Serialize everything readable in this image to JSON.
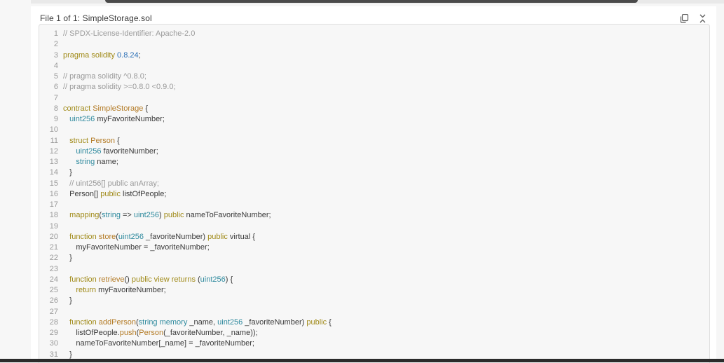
{
  "header": {
    "file_title": "File 1 of 1: SimpleStorage.sol",
    "copy_icon": "copy-icon",
    "collapse_icon": "collapse-icon"
  },
  "code": {
    "language": "solidity",
    "lines": [
      [
        {
          "t": "// SPDX-License-Identifier: Apache-2.0",
          "c": "cm"
        }
      ],
      [],
      [
        {
          "t": "pragma solidity ",
          "c": "kw"
        },
        {
          "t": "0.8.24",
          "c": "num"
        },
        {
          "t": ";",
          "c": ""
        }
      ],
      [],
      [
        {
          "t": "// pragma solidity ^0.8.0;",
          "c": "cm"
        }
      ],
      [
        {
          "t": "// pragma solidity >=0.8.0 <0.9.0;",
          "c": "cm"
        }
      ],
      [],
      [
        {
          "t": "contract ",
          "c": "kw"
        },
        {
          "t": "SimpleStorage",
          "c": "fn"
        },
        {
          "t": " {",
          "c": ""
        }
      ],
      [
        {
          "t": "   ",
          "c": ""
        },
        {
          "t": "uint256",
          "c": "ty"
        },
        {
          "t": " myFavoriteNumber;",
          "c": ""
        }
      ],
      [],
      [
        {
          "t": "   ",
          "c": ""
        },
        {
          "t": "struct ",
          "c": "kw"
        },
        {
          "t": "Person",
          "c": "fn"
        },
        {
          "t": " {",
          "c": ""
        }
      ],
      [
        {
          "t": "      ",
          "c": ""
        },
        {
          "t": "uint256",
          "c": "ty"
        },
        {
          "t": " favoriteNumber;",
          "c": ""
        }
      ],
      [
        {
          "t": "      ",
          "c": ""
        },
        {
          "t": "string",
          "c": "ty"
        },
        {
          "t": " name;",
          "c": ""
        }
      ],
      [
        {
          "t": "   }",
          "c": ""
        }
      ],
      [
        {
          "t": "   // uint256[] public anArray;",
          "c": "cm"
        }
      ],
      [
        {
          "t": "   Person[] ",
          "c": ""
        },
        {
          "t": "public",
          "c": "kw"
        },
        {
          "t": " listOfPeople;",
          "c": ""
        }
      ],
      [],
      [
        {
          "t": "   ",
          "c": ""
        },
        {
          "t": "mapping",
          "c": "kw"
        },
        {
          "t": "(",
          "c": ""
        },
        {
          "t": "string",
          "c": "ty"
        },
        {
          "t": " => ",
          "c": ""
        },
        {
          "t": "uint256",
          "c": "ty"
        },
        {
          "t": ") ",
          "c": ""
        },
        {
          "t": "public",
          "c": "kw"
        },
        {
          "t": " nameToFavoriteNumber;",
          "c": ""
        }
      ],
      [],
      [
        {
          "t": "   ",
          "c": ""
        },
        {
          "t": "function ",
          "c": "kw"
        },
        {
          "t": "store",
          "c": "fn"
        },
        {
          "t": "(",
          "c": ""
        },
        {
          "t": "uint256",
          "c": "ty"
        },
        {
          "t": " _favoriteNumber) ",
          "c": ""
        },
        {
          "t": "public",
          "c": "kw"
        },
        {
          "t": " virtual {",
          "c": ""
        }
      ],
      [
        {
          "t": "      myFavoriteNumber = _favoriteNumber;",
          "c": ""
        }
      ],
      [
        {
          "t": "   }",
          "c": ""
        }
      ],
      [],
      [
        {
          "t": "   ",
          "c": ""
        },
        {
          "t": "function ",
          "c": "kw"
        },
        {
          "t": "retrieve",
          "c": "fn"
        },
        {
          "t": "() ",
          "c": ""
        },
        {
          "t": "public view returns",
          "c": "kw"
        },
        {
          "t": " (",
          "c": ""
        },
        {
          "t": "uint256",
          "c": "ty"
        },
        {
          "t": ") {",
          "c": ""
        }
      ],
      [
        {
          "t": "      ",
          "c": ""
        },
        {
          "t": "return",
          "c": "kw"
        },
        {
          "t": " myFavoriteNumber;",
          "c": ""
        }
      ],
      [
        {
          "t": "   }",
          "c": ""
        }
      ],
      [],
      [
        {
          "t": "   ",
          "c": ""
        },
        {
          "t": "function ",
          "c": "kw"
        },
        {
          "t": "addPerson",
          "c": "fn"
        },
        {
          "t": "(",
          "c": ""
        },
        {
          "t": "string memory",
          "c": "ty"
        },
        {
          "t": " _name, ",
          "c": ""
        },
        {
          "t": "uint256",
          "c": "ty"
        },
        {
          "t": " _favoriteNumber) ",
          "c": ""
        },
        {
          "t": "public",
          "c": "kw"
        },
        {
          "t": " {",
          "c": ""
        }
      ],
      [
        {
          "t": "      listOfPeople.",
          "c": ""
        },
        {
          "t": "push",
          "c": "fn"
        },
        {
          "t": "(",
          "c": ""
        },
        {
          "t": "Person",
          "c": "fn"
        },
        {
          "t": "(_favoriteNumber, _name));",
          "c": ""
        }
      ],
      [
        {
          "t": "      nameToFavoriteNumber[_name] = _favoriteNumber;",
          "c": ""
        }
      ],
      [
        {
          "t": "   }",
          "c": ""
        }
      ]
    ]
  },
  "colors": {
    "keyword": "#a08a18",
    "type": "#2f8a9e",
    "function": "#b37a24",
    "number": "#2b6fb6",
    "comment": "#9a9a9a"
  }
}
